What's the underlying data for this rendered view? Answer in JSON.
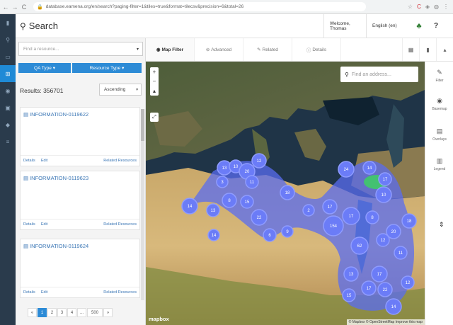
{
  "browser": {
    "url": "database.eamena.org/en/search?paging-filter=1&tiles=true&format=tilecsv&precision=6&total=26",
    "back": "←",
    "forward": "→",
    "reload": "C",
    "lock": "🔒"
  },
  "rail": {
    "items": [
      {
        "name": "home",
        "icon": "▮"
      },
      {
        "name": "search",
        "icon": "⚲"
      },
      {
        "name": "resource",
        "icon": "▭"
      },
      {
        "name": "map",
        "icon": "⊞"
      },
      {
        "name": "graph",
        "icon": "◉"
      },
      {
        "name": "collection",
        "icon": "▣"
      },
      {
        "name": "user",
        "icon": "◆"
      },
      {
        "name": "settings",
        "icon": "≡"
      }
    ]
  },
  "header": {
    "search_icon": "⚲",
    "title": "Search",
    "welcome": "Welcome, Thomas",
    "language": "English (en)",
    "tree_icon": "♣",
    "help_icon": "?"
  },
  "sidebar": {
    "resource_placeholder": "Find a resource...",
    "caret": "▾",
    "qa_type": "QA Type",
    "resource_type": "Resource Type",
    "results": "Results: 356701",
    "sort": "Ascending",
    "cards": [
      {
        "title": "INFORMATION-0119622",
        "details": "Details",
        "edit": "Edit",
        "related": "Related Resources"
      },
      {
        "title": "INFORMATION-0119623",
        "details": "Details",
        "edit": "Edit",
        "related": "Related Resources"
      },
      {
        "title": "INFORMATION-0119624",
        "details": "Details",
        "edit": "Edit",
        "related": "Related Resources"
      }
    ],
    "pager": [
      "«",
      "1",
      "2",
      "3",
      "4",
      "...",
      "500",
      "»"
    ]
  },
  "tabs": [
    {
      "label": "Map Filter",
      "icon": "◉"
    },
    {
      "label": "Advanced",
      "icon": "⊜"
    },
    {
      "label": "Related",
      "icon": "✎"
    },
    {
      "label": "Details",
      "icon": "ⓘ"
    }
  ],
  "tab_icons": [
    "▦",
    "▮",
    "▴"
  ],
  "map": {
    "zoom_in": "+",
    "zoom_out": "−",
    "compass": "▴",
    "fullscreen": "⤢",
    "address_placeholder": "Find an address...",
    "mapbox": "mapbox",
    "attribution": "© Mapbox © OpenStreetMap Improve this map",
    "clusters": [
      {
        "label": "13"
      },
      {
        "label": "10"
      },
      {
        "label": "20"
      },
      {
        "label": "3"
      },
      {
        "label": "12"
      },
      {
        "label": "11"
      },
      {
        "label": "14"
      },
      {
        "label": "13"
      },
      {
        "label": "8"
      },
      {
        "label": "18"
      },
      {
        "label": "22"
      },
      {
        "label": "15"
      },
      {
        "label": "2"
      },
      {
        "label": "6"
      },
      {
        "label": "17"
      },
      {
        "label": "9"
      },
      {
        "label": "14"
      },
      {
        "label": "154"
      },
      {
        "label": "17"
      },
      {
        "label": "62"
      },
      {
        "label": "24"
      },
      {
        "label": "14"
      },
      {
        "label": "10"
      },
      {
        "label": "17"
      },
      {
        "label": "8"
      },
      {
        "label": "20"
      },
      {
        "label": "12"
      },
      {
        "label": "18"
      },
      {
        "label": "11"
      },
      {
        "label": "17"
      },
      {
        "label": "13"
      },
      {
        "label": "15"
      },
      {
        "label": "17"
      },
      {
        "label": "22"
      },
      {
        "label": "14"
      },
      {
        "label": "12"
      }
    ]
  },
  "right_panel": [
    {
      "label": "Filter",
      "icon": "✎"
    },
    {
      "label": "Basemap",
      "icon": "◉"
    },
    {
      "label": "Overlays",
      "icon": "▤"
    },
    {
      "label": "Legend",
      "icon": "▥"
    }
  ],
  "colors": {
    "primary": "#2d8bd6",
    "rail": "#2a3b4c",
    "cluster": "#5a6cf0",
    "cluster_green": "#3bd65c"
  }
}
